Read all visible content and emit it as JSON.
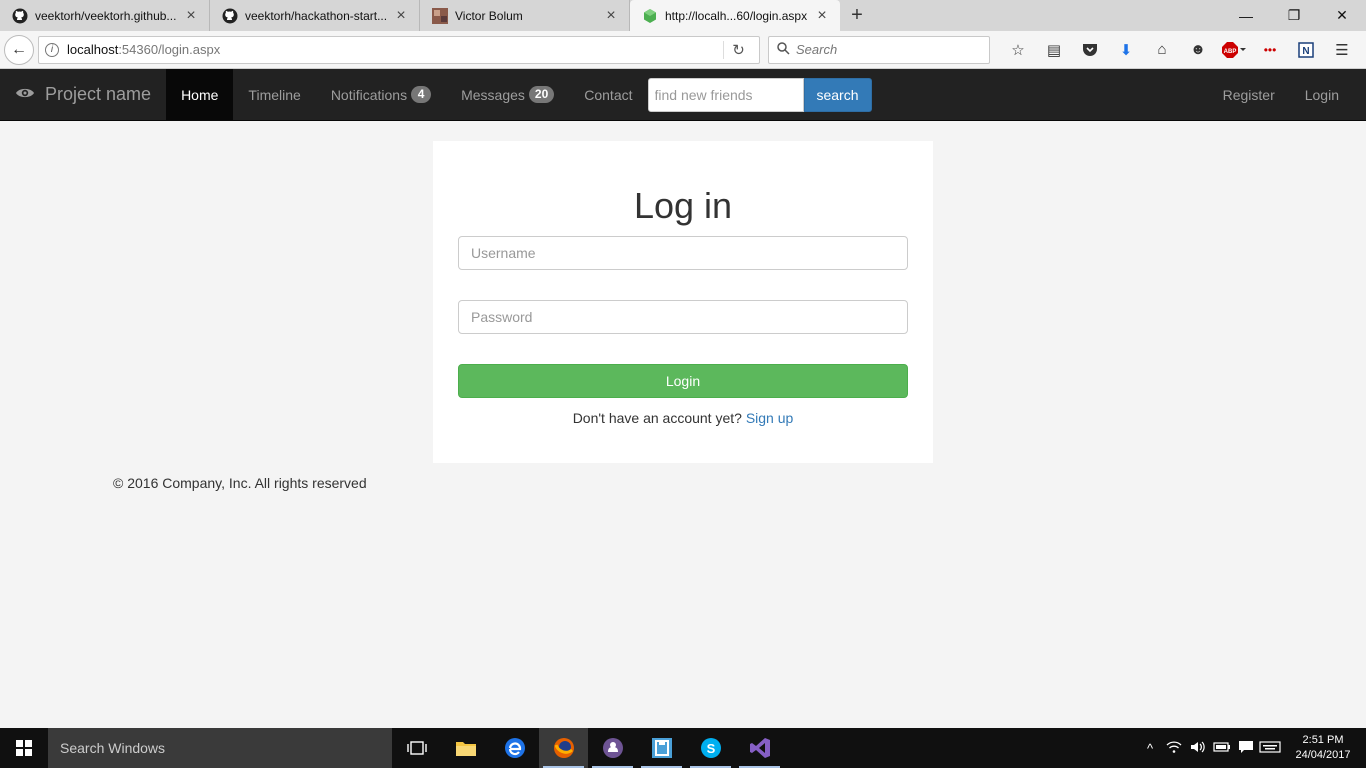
{
  "browser": {
    "tabs": [
      {
        "title": "veektorh/veektorh.github...",
        "icon": "github-icon",
        "active": false
      },
      {
        "title": "veektorh/hackathon-start...",
        "icon": "github-icon",
        "active": false
      },
      {
        "title": "Victor Bolum",
        "icon": "profile-image-icon",
        "active": false
      },
      {
        "title": "http://localh...60/login.aspx",
        "icon": "green-cube-icon",
        "active": true
      }
    ],
    "new_tab_label": "+",
    "window_controls": {
      "minimize": "—",
      "restore": "❐",
      "close": "✕"
    },
    "url_host": "localhost",
    "url_rest": ":54360/login.aspx",
    "search_placeholder": "Search"
  },
  "site": {
    "brand": "Project name",
    "nav": [
      {
        "label": "Home",
        "active": true
      },
      {
        "label": "Timeline"
      },
      {
        "label": "Notifications",
        "badge": "4"
      },
      {
        "label": "Messages",
        "badge": "20"
      },
      {
        "label": "Contact"
      }
    ],
    "friend_search": {
      "placeholder": "find new friends",
      "button": "search"
    },
    "nav_right": [
      "Register",
      "Login"
    ]
  },
  "login": {
    "title": "Log in",
    "username_placeholder": "Username",
    "password_placeholder": "Password",
    "submit": "Login",
    "signup_prompt": "Don't have an account yet?",
    "signup_link": "Sign up"
  },
  "footer": "© 2016 Company, Inc. All rights reserved",
  "taskbar": {
    "search_placeholder": "Search Windows",
    "clock_time": "2:51 PM",
    "clock_date": "24/04/2017",
    "accent": "#5cb85c"
  }
}
